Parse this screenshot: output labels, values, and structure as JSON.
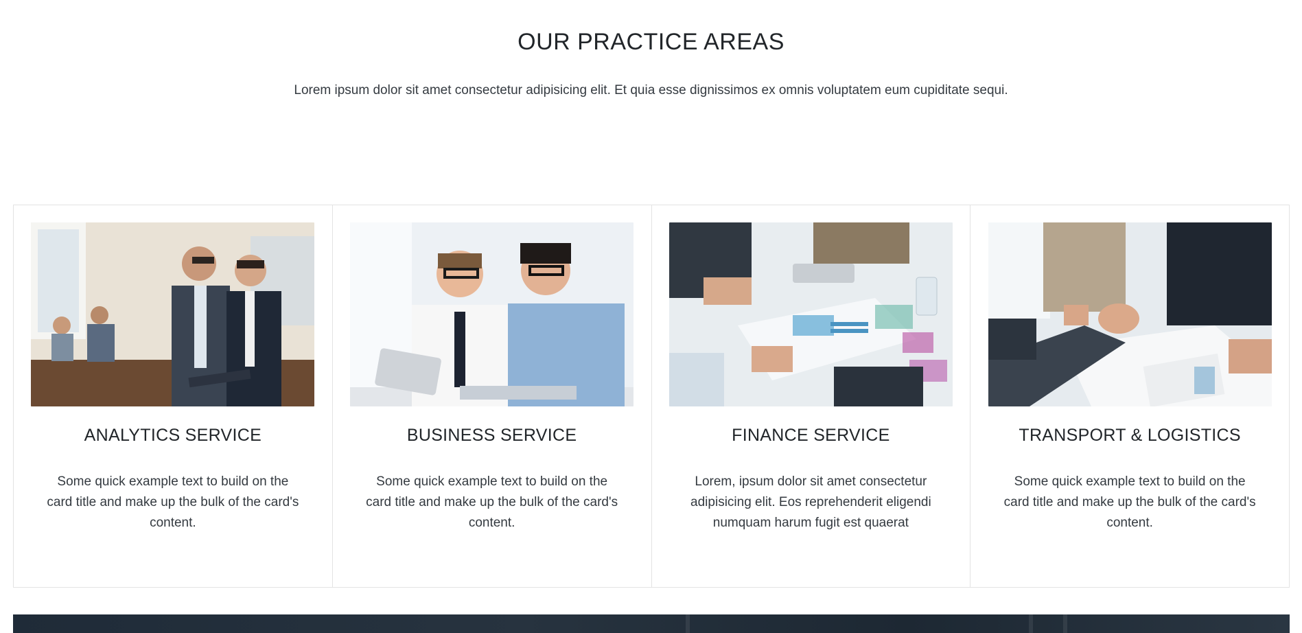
{
  "section": {
    "title": "OUR PRACTICE AREAS",
    "subtitle": "Lorem ipsum dolor sit amet consectetur adipisicing elit. Et quia esse dignissimos ex omnis voluptatem eum cupiditate sequi."
  },
  "cards": [
    {
      "title": "ANALYTICS SERVICE",
      "text": "Some quick example text to build on the card title and make up the bulk of the card's content."
    },
    {
      "title": "BUSINESS SERVICE",
      "text": "Some quick example text to build on the card title and make up the bulk of the card's content."
    },
    {
      "title": "FINANCE SERVICE",
      "text": "Lorem, ipsum dolor sit amet consectetur adipisicing elit. Eos reprehenderit eligendi numquam harum fugit est quaerat"
    },
    {
      "title": "TRANSPORT & LOGISTICS",
      "text": "Some quick example text to build on the card title and make up the bulk of the card's content."
    }
  ]
}
